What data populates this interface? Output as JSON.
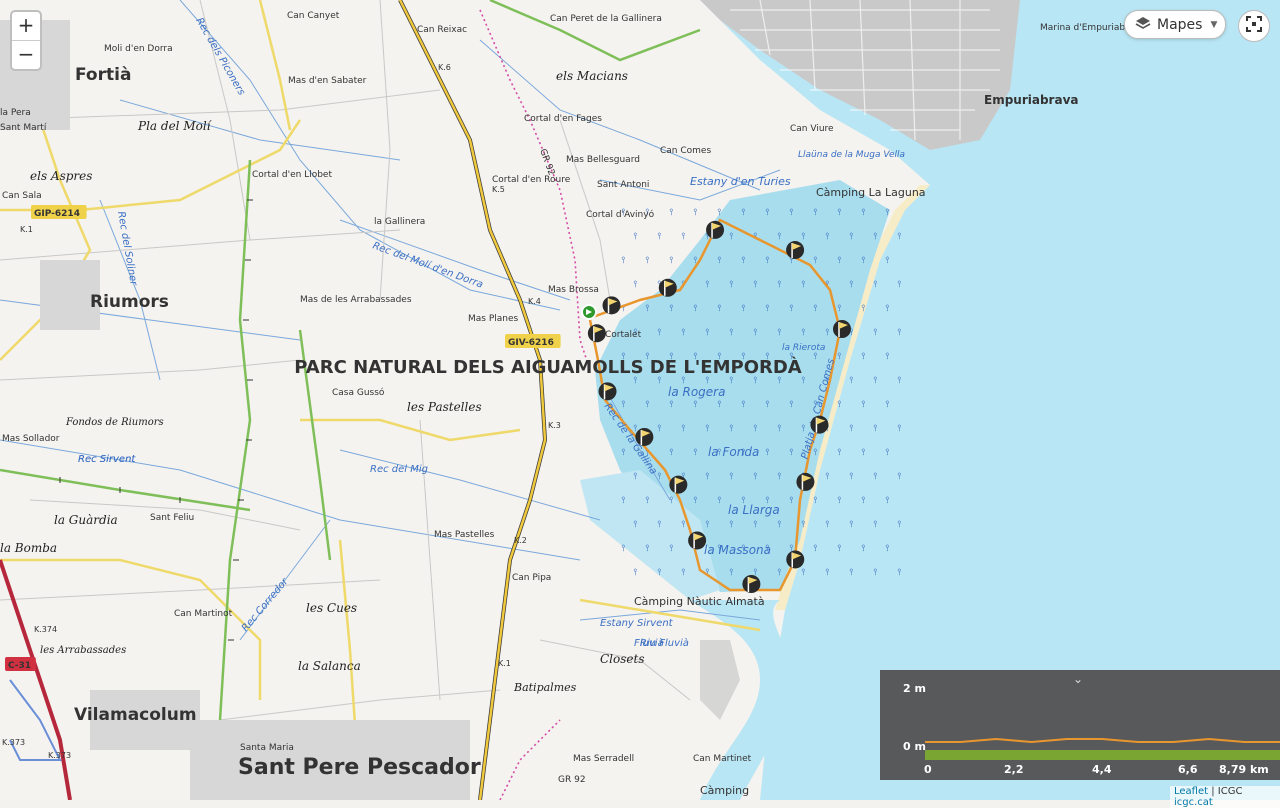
{
  "map": {
    "park_name": "PARC NATURAL DELS AIGUAMOLLS DE L'EMPORDÀ",
    "towns": [
      {
        "name": "Fortià",
        "size": "l"
      },
      {
        "name": "Riumors",
        "size": "l"
      },
      {
        "name": "Vilamacolum",
        "size": "l"
      },
      {
        "name": "Sant Pere Pescador",
        "size": "xl"
      },
      {
        "name": "Empuriabrava",
        "size": "m"
      }
    ],
    "places": [
      "Can Canyet",
      "Moli d'en Dorra",
      "Mas d'en Sabater",
      "Can Reixac",
      "Can Peret de la Gallinera",
      "Cortal d'en Fages",
      "Mas Bellesguard",
      "Can Comes",
      "Can Viure",
      "Cortal d'en Roure",
      "Sant Antoni",
      "Cortal d'Avinyó",
      "Cortal d'en Llobet",
      "la Gallinera",
      "Can Sala",
      "Mas Brossa",
      "Mas de les Arrabassades",
      "Mas Planes",
      "Cortalet",
      "Casa Gussó",
      "Mas Sollador",
      "Mas Pastelles",
      "Can Pipa",
      "Can Martinot",
      "Mas Serradell",
      "Can Martinet",
      "Santa Maria",
      "la Pera",
      "Sant Martí",
      "Sant Feliu",
      "Marina d'Empuriabrava"
    ],
    "areas": [
      "els Macians",
      "Pla del Molí",
      "els Aspres",
      "les Pastelles",
      "Fondos de Riumors",
      "la Guàrdia",
      "la Bomba",
      "les Cues",
      "la Salanca",
      "les Arrabassades",
      "Closets",
      "Batipalmes"
    ],
    "water": [
      "Rec dels Piconers",
      "Rec del Molí d'en Dorra",
      "Rec del Soliner",
      "Rec Sirvent",
      "Rec del Mig",
      "Rec Corredor",
      "Rec de la Gallina",
      "Estany d'en Turies",
      "Llaüna de la Muga Vella",
      "la Rierota",
      "la Rogera",
      "la Fonda",
      "la Llarga",
      "la Massona",
      "Estany Sirvent",
      "Platja de Can Comes",
      "Fluvià",
      "Riu Fluvià",
      "Rec Sirvent"
    ],
    "roads": [
      "GIP-6214",
      "GIV-6216",
      "C-31",
      "GR 92",
      "GR 92"
    ],
    "km_markers": [
      "K.6",
      "K.5",
      "K.4",
      "K.3",
      "K.2",
      "K.1",
      "K.1",
      "K.374",
      "K.373",
      "K.373"
    ],
    "campings": [
      "Càmping La Laguna",
      "Càmping Nàutic Almatà",
      "Càmping"
    ],
    "colors": {
      "route": "#e8962e",
      "water": "#a8ddee",
      "sea": "#b9e6f4",
      "land": "#f4f2ee",
      "park_label": "#2e8b2e"
    }
  },
  "controls": {
    "zoom_in": "+",
    "zoom_out": "−",
    "layers_label": "Mapes",
    "layers_icon": "layers-icon",
    "fullscreen_icon": "fullscreen-icon"
  },
  "elevation": {
    "y_ticks": [
      "2 m",
      "0 m"
    ],
    "x_ticks": [
      "0",
      "2,2",
      "4,4",
      "6,6",
      "8,79 km"
    ],
    "total_km": 8.79,
    "profile_m": [
      0.2,
      0.2,
      0.3,
      0.2,
      0.3,
      0.3,
      0.2,
      0.2,
      0.3,
      0.2,
      0.2
    ]
  },
  "attribution": {
    "leaflet": "Leaflet",
    "sep1": " | ",
    "icgc": "ICGC",
    "sep2": " ",
    "site": "icgc.cat"
  }
}
